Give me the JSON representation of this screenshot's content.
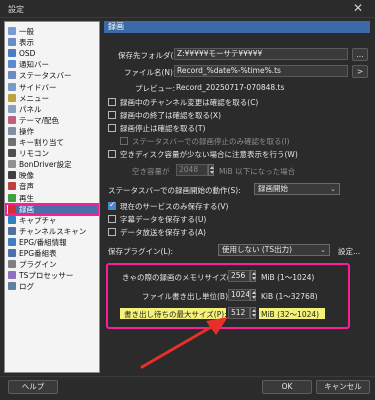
{
  "window": {
    "title": "設定",
    "close_glyph": "✕"
  },
  "tree": {
    "items": [
      {
        "label": "一般",
        "color": "#7a9bd1"
      },
      {
        "label": "表示",
        "color": "#6b8bc4"
      },
      {
        "label": "OSD",
        "color": "#4a7ac0"
      },
      {
        "label": "通知バー",
        "color": "#5a8ad0"
      },
      {
        "label": "ステータスバー",
        "color": "#6a8ac0"
      },
      {
        "label": "サイドバー",
        "color": "#7a9ac8"
      },
      {
        "label": "メニュー",
        "color": "#c0a040"
      },
      {
        "label": "パネル",
        "color": "#8aa0c0"
      },
      {
        "label": "テーマ/配色",
        "color": "#c06080"
      },
      {
        "label": "操作",
        "color": "#8090a0"
      },
      {
        "label": "キー割り当て",
        "color": "#707070"
      },
      {
        "label": "リモコン",
        "color": "#505050"
      },
      {
        "label": "BonDriver設定",
        "color": "#909090"
      },
      {
        "label": "映像",
        "color": "#404040"
      },
      {
        "label": "音声",
        "color": "#c04040"
      },
      {
        "label": "再生",
        "color": "#40a040"
      },
      {
        "label": "録画",
        "color": "#d03030"
      },
      {
        "label": "キャプチャ",
        "color": "#3080c0"
      },
      {
        "label": "チャンネルスキャン",
        "color": "#5070a0"
      },
      {
        "label": "EPG/番組情報",
        "color": "#4080c0"
      },
      {
        "label": "EPG番組表",
        "color": "#4a70b0"
      },
      {
        "label": "プラグイン",
        "color": "#808080"
      },
      {
        "label": "TSプロセッサー",
        "color": "#9070c0"
      },
      {
        "label": "ログ",
        "color": "#6080a0"
      }
    ],
    "selected": "録画"
  },
  "panel": {
    "header": "録画",
    "folder_label": "保存先フォルダ(F):",
    "folder_value": "Z:¥¥¥¥¥モーサテ¥¥¥¥¥",
    "browse_label": "...",
    "filename_label": "ファイル名(N):",
    "filename_value": "Record_%date%-%time%.ts",
    "filename_btn": ">",
    "preview_label": "プレビュー:",
    "preview_value": "Record_20250717-070848.ts",
    "checks": [
      {
        "label": "録画中のチャンネル変更は確認を取る(C)",
        "checked": false
      },
      {
        "label": "録画中の終了は確認を取る(X)",
        "checked": false
      },
      {
        "label": "録画停止は確認を取る(T)",
        "checked": false
      },
      {
        "label": "ステータスバーでの録画停止のみ確認を取る(I)",
        "checked": false,
        "disabled": true
      },
      {
        "label": "空きディスク容量が少ない場合に注意表示を行う(W)",
        "checked": false
      }
    ],
    "free_space_label": "空き容量が",
    "free_space_value": "2048",
    "free_space_suffix": "MiB 以下になった場合",
    "statusbar_action_label": "ステータスバーでの録画開始の動作(S):",
    "statusbar_action_value": "録画開始",
    "checks2": [
      {
        "label": "現在のサービスのみ保存する(V)",
        "checked": true
      },
      {
        "label": "字幕データを保存する(U)",
        "checked": false
      },
      {
        "label": "データ放送を保存する(A)",
        "checked": false
      }
    ],
    "plugin_label": "保存プラグイン(L):",
    "plugin_value": "使用しない (TS出力)",
    "plugin_btn": "設定...",
    "memory": [
      {
        "label": "きゃの際の録画のメモリサイズ(H):",
        "value": "256",
        "unit": "MiB (1〜1024)"
      },
      {
        "label": "ファイル書き出し単位(B):",
        "value": "1024",
        "unit": "KiB (1〜32768)"
      },
      {
        "label": "書き出し待ちの最大サイズ(P):",
        "value": "512",
        "unit": "MiB (32〜1024)"
      }
    ]
  },
  "footer": {
    "help": "ヘルプ",
    "ok": "OK",
    "cancel": "キャンセル"
  },
  "colors": {
    "highlight": "#ff1c9a",
    "selected": "#4a6fa8",
    "header": "#3b6aa8",
    "arrow": "#e8302a"
  }
}
